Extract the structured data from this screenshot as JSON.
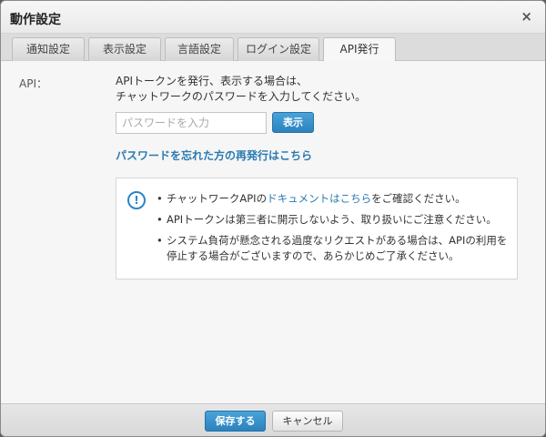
{
  "dialog": {
    "title": "動作設定",
    "close_icon": "close-icon",
    "close_glyph": "×"
  },
  "tabs": [
    {
      "label": "通知設定",
      "active": false
    },
    {
      "label": "表示設定",
      "active": false
    },
    {
      "label": "言語設定",
      "active": false
    },
    {
      "label": "ログイン設定",
      "active": false
    },
    {
      "label": "API発行",
      "active": true
    }
  ],
  "api": {
    "label": "API：",
    "description_line1": "APIトークンを発行、表示する場合は、",
    "description_line2": "チャットワークのパスワードを入力してください。",
    "password_placeholder": "パスワードを入力",
    "password_value": "",
    "show_button": "表示",
    "reissue_link": "パスワードを忘れた方の再発行はこちら"
  },
  "notice": {
    "icon": "info-icon",
    "icon_glyph": "!",
    "item1_prefix": "チャットワークAPIの",
    "item1_link": "ドキュメントはこちら",
    "item1_suffix": "をご確認ください。",
    "item2": "APIトークンは第三者に開示しないよう、取り扱いにご注意ください。",
    "item3": "システム負荷が懸念される過度なリクエストがある場合は、APIの利用を停止する場合がございますので、あらかじめご了承ください。"
  },
  "footer": {
    "save_button": "保存する",
    "cancel_button": "キャンセル"
  },
  "colors": {
    "accent": "#2b82bd",
    "link": "#2a7ab0"
  }
}
